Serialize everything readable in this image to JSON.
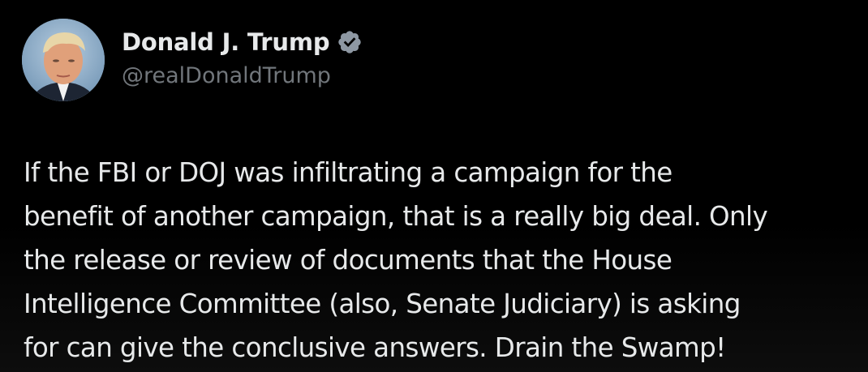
{
  "author": {
    "display_name": "Donald J. Trump",
    "handle": "@realDonaldTrump",
    "verified": true,
    "verified_icon": "verified-badge-icon",
    "verified_color": "#1d9bf0"
  },
  "tweet": {
    "lines": [
      "If the FBI or DOJ was infiltrating a campaign for the",
      "benefit of another campaign, that is a really big deal. Only",
      "the release or review of documents that the House",
      "Intelligence Committee (also, Senate Judiciary) is asking",
      "for can give the conclusive answers. Drain the Swamp!"
    ]
  },
  "colors": {
    "background": "#000000",
    "text_primary": "#e7e9ea",
    "text_secondary": "#71767b"
  }
}
